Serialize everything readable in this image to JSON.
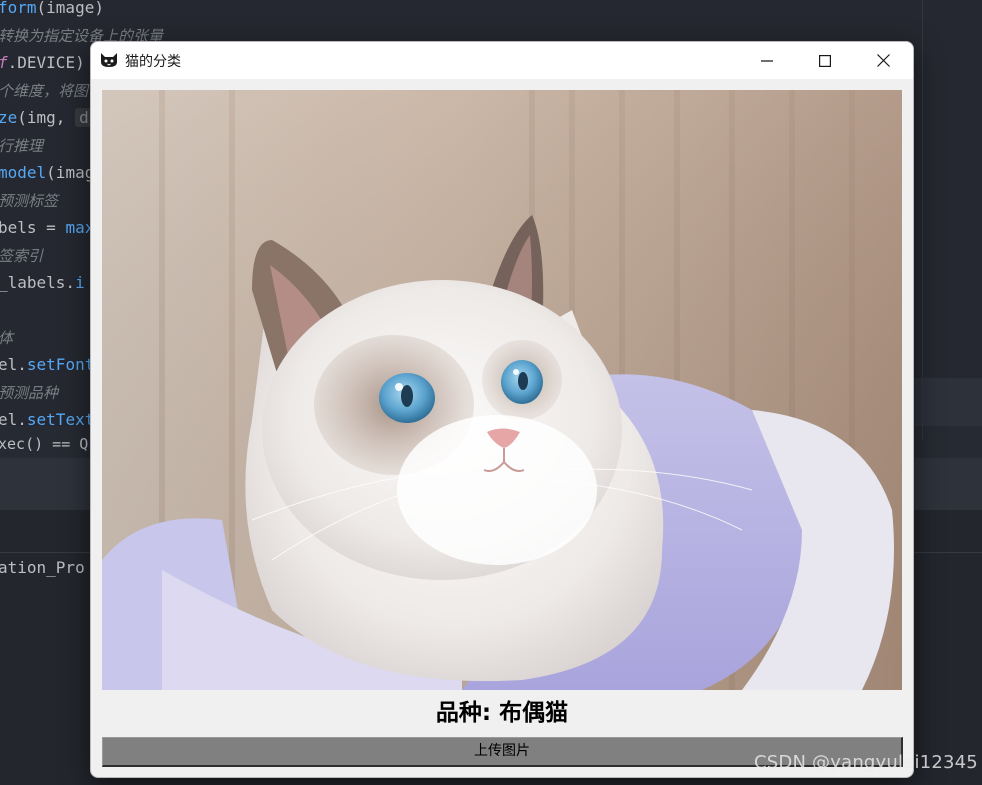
{
  "ide": {
    "lines": [
      {
        "t": "form",
        "rest": "(image)"
      },
      {
        "t": "转换为指定设备上的张量"
      },
      {
        "t": "f",
        "rest": ".DEVICE)"
      },
      {
        "t": "个维度，将图"
      },
      {
        "t": "ze",
        "rest": "(img,",
        "inlay": "d"
      },
      {
        "t": "行推理"
      },
      {
        "t": "model",
        "rest": "(imag"
      },
      {
        "t": "预测标签"
      },
      {
        "t": "bels = ",
        "fn": "max"
      },
      {
        "t": "签索引"
      },
      {
        "t": "_labels.",
        "fn": "i"
      },
      {
        "t": "体"
      },
      {
        "t": "el.",
        "fn": "setFont"
      },
      {
        "t": "预测品种"
      },
      {
        "t": "el.",
        "fn": "setText"
      },
      {
        "t": "xec() == QFi"
      },
      {
        "t": "ation_Pro"
      }
    ]
  },
  "window": {
    "title": "猫的分类",
    "icon": "cat-face-icon",
    "controls": [
      "minimize-icon",
      "maximize-icon",
      "close-icon"
    ]
  },
  "main": {
    "image_subject": "cat-photo",
    "breed_label": "品种: 布偶猫",
    "upload_button": "上传图片"
  },
  "watermark": "CSDN @yangyulei12345",
  "colors": {
    "ide_bg": "#252830",
    "window_bg": "#f0f0f0",
    "button_bg": "#808080",
    "titlebar_bg": "#ffffff"
  }
}
